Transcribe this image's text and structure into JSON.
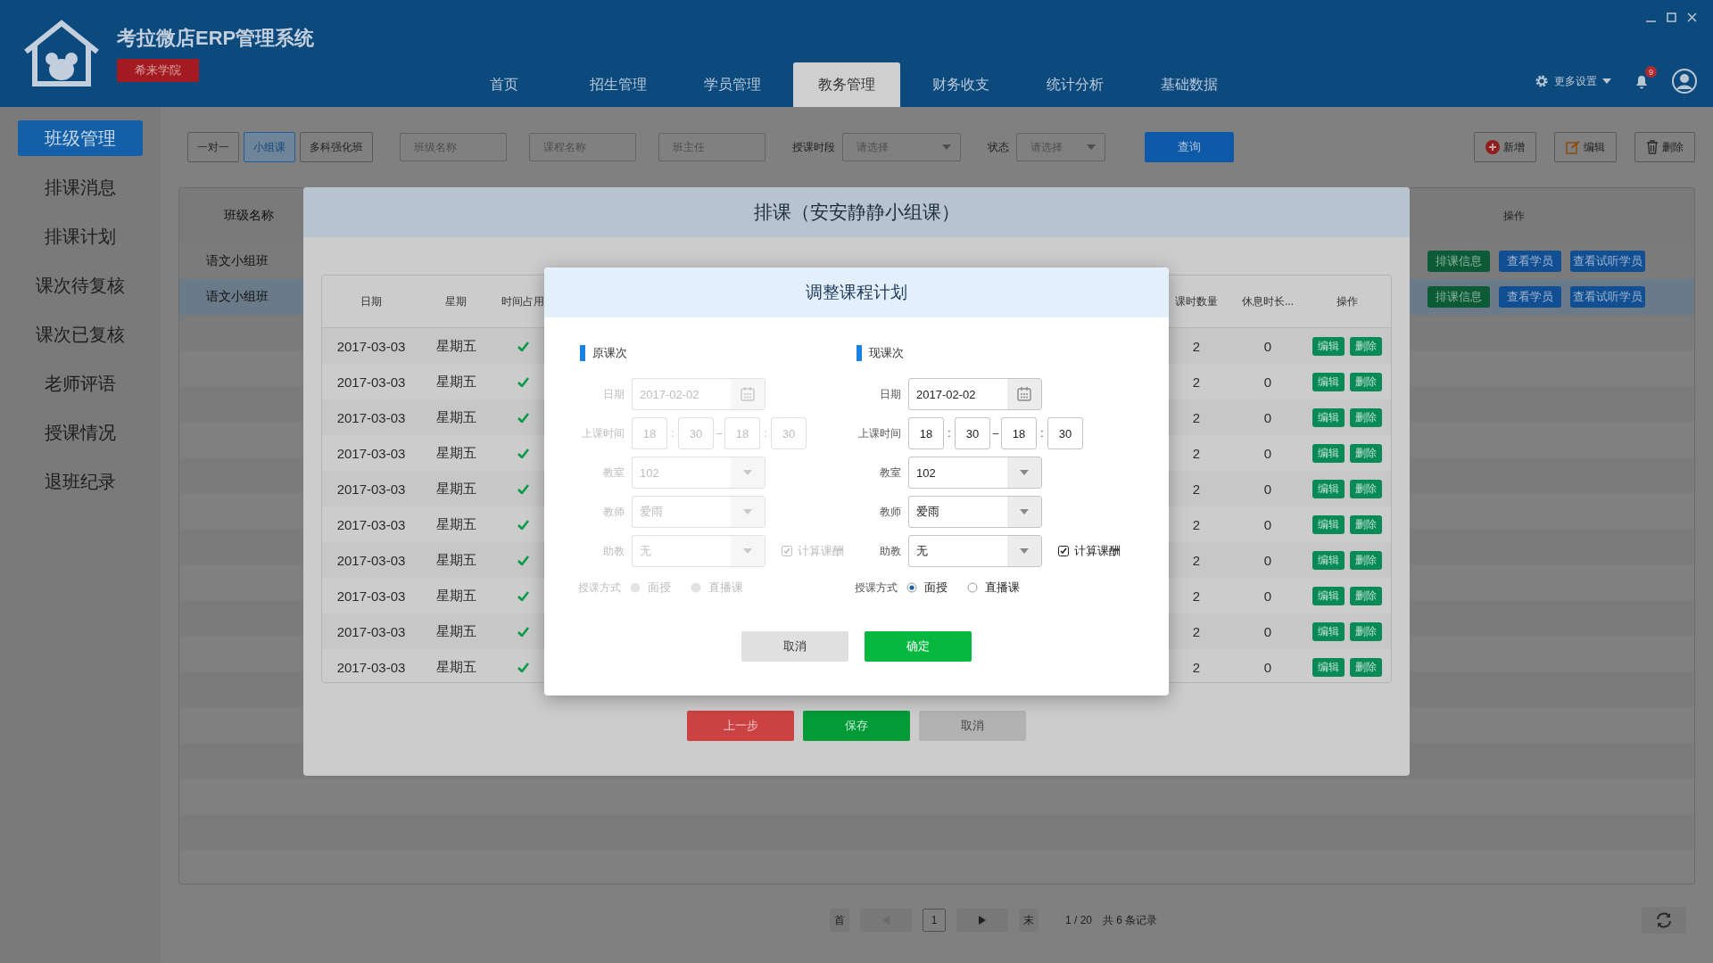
{
  "header": {
    "title": "考拉微店ERP管理系统",
    "badge": "希来学院",
    "nav": [
      {
        "label": "首页",
        "selected": false
      },
      {
        "label": "招生管理",
        "selected": false
      },
      {
        "label": "学员管理",
        "selected": false
      },
      {
        "label": "教务管理",
        "selected": true
      },
      {
        "label": "财务收支",
        "selected": false
      },
      {
        "label": "统计分析",
        "selected": false
      },
      {
        "label": "基础数据",
        "selected": false
      }
    ],
    "settings": "更多设置",
    "notification_count": "9"
  },
  "sidebar": {
    "items": [
      {
        "label": "班级管理",
        "selected": true
      },
      {
        "label": "排课消息",
        "selected": false
      },
      {
        "label": "排课计划",
        "selected": false
      },
      {
        "label": "课次待复核",
        "selected": false
      },
      {
        "label": "课次已复核",
        "selected": false
      },
      {
        "label": "老师评语",
        "selected": false
      },
      {
        "label": "授课情况",
        "selected": false
      },
      {
        "label": "退班纪录",
        "selected": false
      }
    ]
  },
  "toolbar": {
    "class_types": [
      {
        "label": "一对一",
        "selected": false
      },
      {
        "label": "小组课",
        "selected": true
      },
      {
        "label": "多科强化班",
        "selected": false
      }
    ],
    "filters": [
      {
        "placeholder": "班级名称"
      },
      {
        "placeholder": "课程名称"
      },
      {
        "placeholder": "班主任"
      }
    ],
    "period": {
      "label": "授课时段",
      "placeholder": "请选择"
    },
    "status": {
      "label": "状态",
      "placeholder": "请选择"
    },
    "search_button": "查询",
    "actions": [
      {
        "label": "新增",
        "kind": "add"
      },
      {
        "label": "编辑",
        "kind": "edit"
      },
      {
        "label": "删除",
        "kind": "delete"
      }
    ]
  },
  "class_table": {
    "columns": [
      "班级名称",
      "操作"
    ],
    "rows": [
      {
        "name": "语文小组班",
        "selected": false,
        "actions": [
          {
            "label": "排课信息",
            "kind": "schedule"
          },
          {
            "label": "查看学员",
            "kind": "view"
          },
          {
            "label": "查看试听学员",
            "kind": "view"
          }
        ]
      },
      {
        "name": "语文小组班",
        "selected": true,
        "actions": [
          {
            "label": "排课信息",
            "kind": "schedule"
          },
          {
            "label": "查看学员",
            "kind": "view"
          },
          {
            "label": "查看试听学员",
            "kind": "view"
          }
        ]
      }
    ]
  },
  "pagination": {
    "first": "首",
    "page": "1",
    "last": "末",
    "page_info": "1 / 20",
    "total": "共 6 条记录"
  },
  "schedule_dialog": {
    "title": "排课（安安静静小组课）",
    "columns_left": [
      "日期",
      "星期",
      "时间占用"
    ],
    "columns_right": [
      "课时数量",
      "休息时长...",
      "操作"
    ],
    "rows": [
      {
        "date": "2017-03-03",
        "weekday": "星期五",
        "occupied": true,
        "hours": "2",
        "rest": "0",
        "actions": [
          "编辑",
          "删除"
        ]
      },
      {
        "date": "2017-03-03",
        "weekday": "星期五",
        "occupied": true,
        "hours": "2",
        "rest": "0",
        "actions": [
          "编辑",
          "删除"
        ]
      },
      {
        "date": "2017-03-03",
        "weekday": "星期五",
        "occupied": true,
        "hours": "2",
        "rest": "0",
        "actions": [
          "编辑",
          "删除"
        ]
      },
      {
        "date": "2017-03-03",
        "weekday": "星期五",
        "occupied": true,
        "hours": "2",
        "rest": "0",
        "actions": [
          "编辑",
          "删除"
        ]
      },
      {
        "date": "2017-03-03",
        "weekday": "星期五",
        "occupied": true,
        "hours": "2",
        "rest": "0",
        "actions": [
          "编辑",
          "删除"
        ]
      },
      {
        "date": "2017-03-03",
        "weekday": "星期五",
        "occupied": true,
        "hours": "2",
        "rest": "0",
        "actions": [
          "编辑",
          "删除"
        ]
      },
      {
        "date": "2017-03-03",
        "weekday": "星期五",
        "occupied": true,
        "hours": "2",
        "rest": "0",
        "actions": [
          "编辑",
          "删除"
        ]
      },
      {
        "date": "2017-03-03",
        "weekday": "星期五",
        "occupied": true,
        "hours": "2",
        "rest": "0",
        "actions": [
          "编辑",
          "删除"
        ]
      },
      {
        "date": "2017-03-03",
        "weekday": "星期五",
        "occupied": true,
        "hours": "2",
        "rest": "0",
        "actions": [
          "编辑",
          "删除"
        ]
      },
      {
        "date": "2017-03-03",
        "weekday": "星期五",
        "occupied": true,
        "hours": "2",
        "rest": "0",
        "actions": [
          "编辑",
          "删除"
        ]
      }
    ],
    "buttons": [
      {
        "label": "上一步",
        "kind": "prev"
      },
      {
        "label": "保存",
        "kind": "save"
      },
      {
        "label": "取消",
        "kind": "cancel"
      }
    ]
  },
  "adjust_dialog": {
    "title": "调整课程计划",
    "sections": [
      {
        "heading": "原课次",
        "disabled": true,
        "date_label": "日期",
        "date": "2017-02-02",
        "time_label": "上课时间",
        "time_parts": [
          {
            "kind": "box",
            "value": "18"
          },
          {
            "kind": "sep",
            "value": ":"
          },
          {
            "kind": "box",
            "value": "30"
          },
          {
            "kind": "sep",
            "value": "–"
          },
          {
            "kind": "box",
            "value": "18"
          },
          {
            "kind": "sep",
            "value": ":"
          },
          {
            "kind": "box",
            "value": "30"
          }
        ],
        "room_label": "教室",
        "room": "102",
        "teacher_label": "教师",
        "teacher": "爱雨",
        "assistant_label": "助教",
        "assistant": "无",
        "pay": {
          "label": "计算课酬",
          "checked": true
        },
        "mode_label": "授课方式",
        "modes": [
          {
            "label": "面授",
            "selected": false
          },
          {
            "label": "直播课",
            "selected": false
          }
        ]
      },
      {
        "heading": "现课次",
        "disabled": false,
        "date_label": "日期",
        "date": "2017-02-02",
        "time_label": "上课时间",
        "time_parts": [
          {
            "kind": "box",
            "value": "18"
          },
          {
            "kind": "sep",
            "value": ":"
          },
          {
            "kind": "box",
            "value": "30"
          },
          {
            "kind": "sep",
            "value": "–"
          },
          {
            "kind": "box",
            "value": "18"
          },
          {
            "kind": "sep",
            "value": ":"
          },
          {
            "kind": "box",
            "value": "30"
          }
        ],
        "room_label": "教室",
        "room": "102",
        "teacher_label": "教师",
        "teacher": "爱雨",
        "assistant_label": "助教",
        "assistant": "无",
        "pay": {
          "label": "计算课酬",
          "checked": true
        },
        "mode_label": "授课方式",
        "modes": [
          {
            "label": "面授",
            "selected": true
          },
          {
            "label": "直播课",
            "selected": false
          }
        ]
      }
    ],
    "buttons": [
      {
        "label": "取消",
        "kind": "cancel"
      },
      {
        "label": "确定",
        "kind": "confirm"
      }
    ]
  }
}
